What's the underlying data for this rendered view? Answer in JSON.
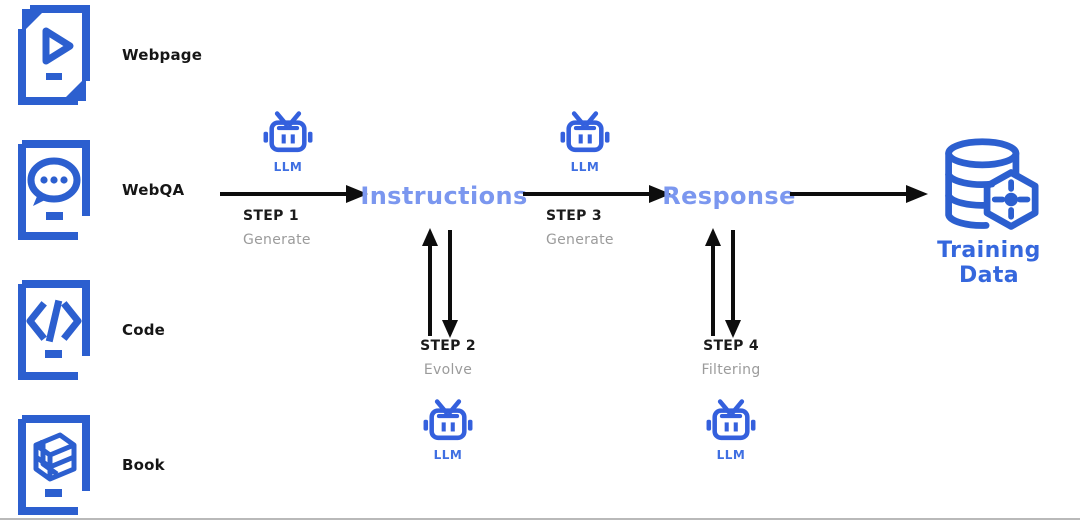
{
  "colors": {
    "icon_blue": "#2c5fcf",
    "node_blue": "#7b97ef",
    "accent_blue": "#3567dd",
    "llm_blue": "#3f6fe2",
    "arrow_black": "#0d0d0d",
    "sub_gray": "#9b9b9b",
    "background": "#ffffff"
  },
  "sources": [
    {
      "label": "Webpage",
      "icon": "webpage-document-icon"
    },
    {
      "label": "WebQA",
      "icon": "chat-document-icon"
    },
    {
      "label": "Code",
      "icon": "code-document-icon"
    },
    {
      "label": "Book",
      "icon": "cube-document-icon"
    }
  ],
  "pipeline": {
    "nodes": [
      {
        "id": "instructions",
        "label": "Instructions"
      },
      {
        "id": "response",
        "label": "Response"
      }
    ],
    "steps": [
      {
        "id": "step1",
        "title": "STEP 1",
        "subtitle": "Generate"
      },
      {
        "id": "step2",
        "title": "STEP 2",
        "subtitle": "Evolve"
      },
      {
        "id": "step3",
        "title": "STEP 3",
        "subtitle": "Generate"
      },
      {
        "id": "step4",
        "title": "STEP 4",
        "subtitle": "Filtering"
      }
    ],
    "llm_nodes": [
      {
        "id": "llm1",
        "caption": "LLM",
        "icon": "robot-icon"
      },
      {
        "id": "llm2",
        "caption": "LLM",
        "icon": "robot-icon"
      },
      {
        "id": "llm3",
        "caption": "LLM",
        "icon": "robot-icon"
      },
      {
        "id": "llm4",
        "caption": "LLM",
        "icon": "robot-icon"
      }
    ]
  },
  "output": {
    "label": "Training Data",
    "icon": "database-node-icon"
  }
}
